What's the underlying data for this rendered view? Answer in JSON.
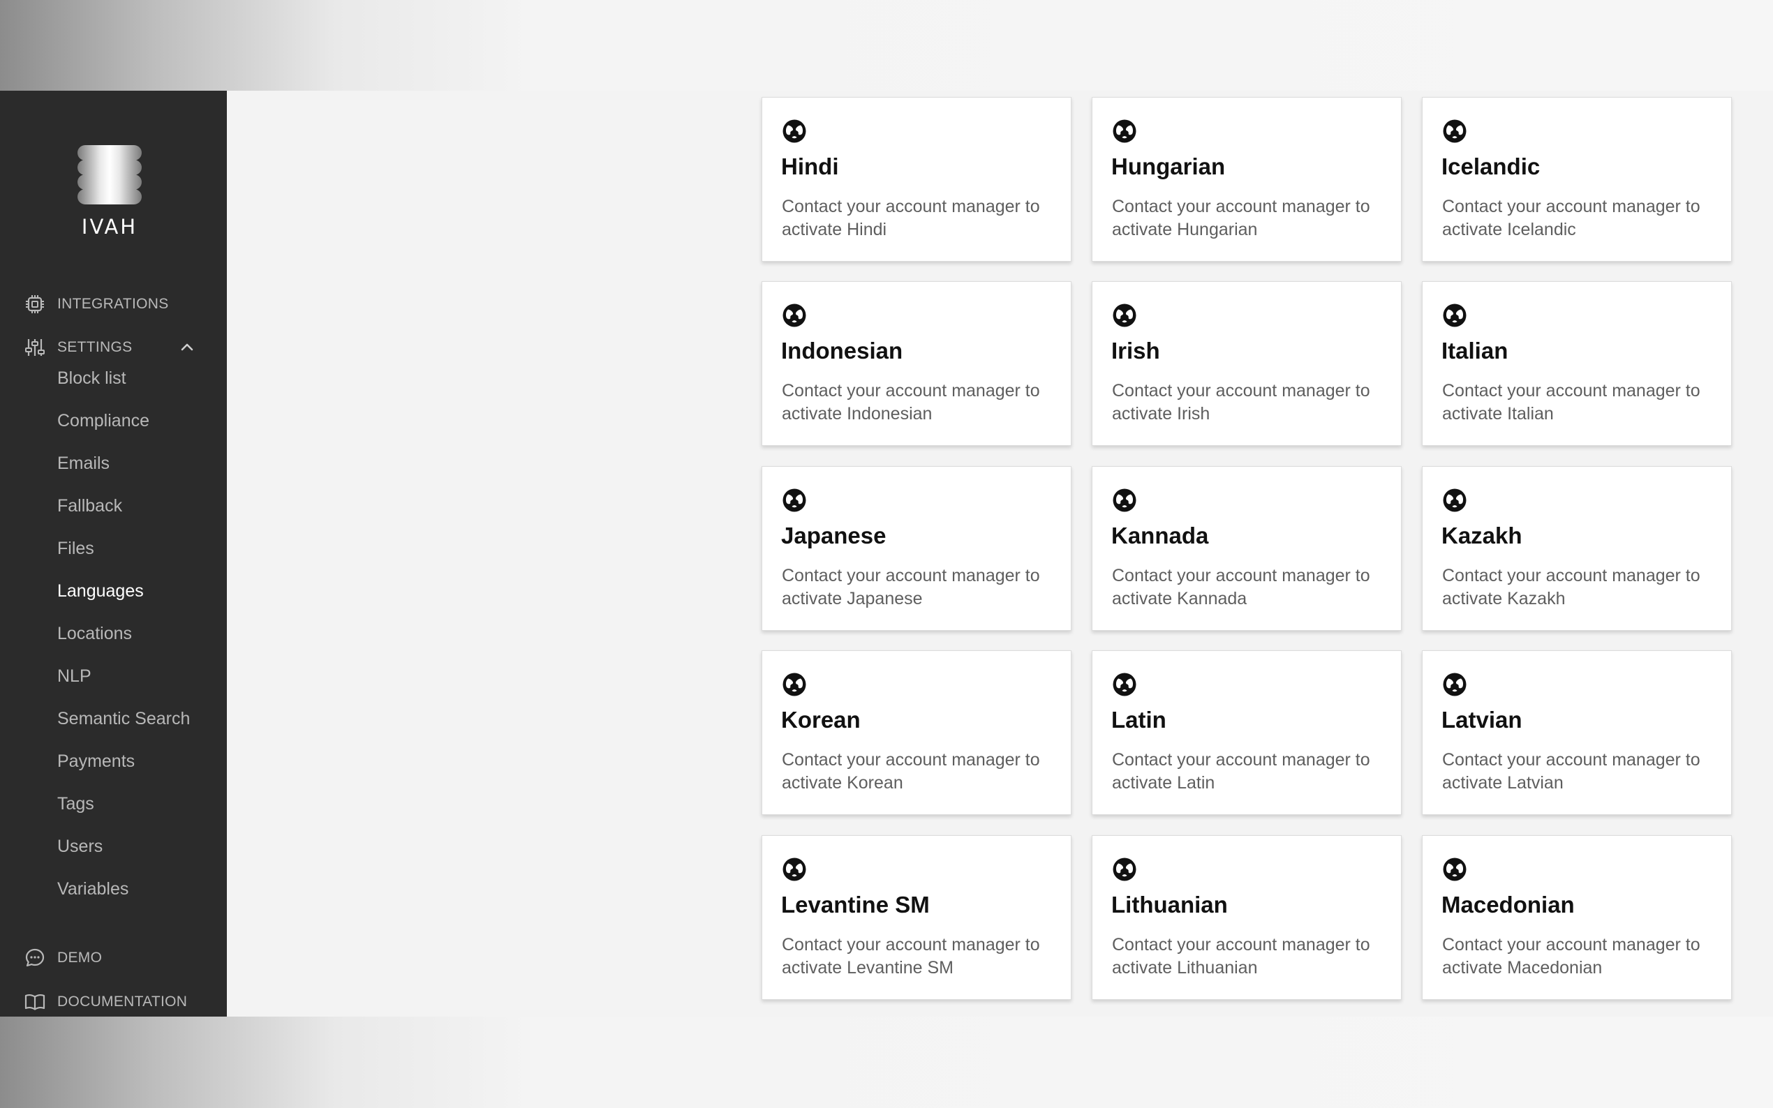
{
  "brand": {
    "name": "IVAH"
  },
  "nav": {
    "integrations": "INTEGRATIONS",
    "settings": "SETTINGS",
    "settings_items": [
      "Block list",
      "Compliance",
      "Emails",
      "Fallback",
      "Files",
      "Languages",
      "Locations",
      "NLP",
      "Semantic Search",
      "Payments",
      "Tags",
      "Users",
      "Variables"
    ],
    "active_item": "Languages",
    "demo": "DEMO",
    "documentation": "DOCUMENTATION"
  },
  "languages": [
    {
      "name": "Hindi",
      "desc": "Contact your account manager to activate Hindi"
    },
    {
      "name": "Hungarian",
      "desc": "Contact your account manager to activate Hungarian"
    },
    {
      "name": "Icelandic",
      "desc": "Contact your account manager to activate Icelandic"
    },
    {
      "name": "Indonesian",
      "desc": "Contact your account manager to activate Indonesian"
    },
    {
      "name": "Irish",
      "desc": "Contact your account manager to activate Irish"
    },
    {
      "name": "Italian",
      "desc": "Contact your account manager to activate Italian"
    },
    {
      "name": "Japanese",
      "desc": "Contact your account manager to activate Japanese"
    },
    {
      "name": "Kannada",
      "desc": "Contact your account manager to activate Kannada"
    },
    {
      "name": "Kazakh",
      "desc": "Contact your account manager to activate Kazakh"
    },
    {
      "name": "Korean",
      "desc": "Contact your account manager to activate Korean"
    },
    {
      "name": "Latin",
      "desc": "Contact your account manager to activate Latin"
    },
    {
      "name": "Latvian",
      "desc": "Contact your account manager to activate Latvian"
    },
    {
      "name": "Levantine SM",
      "desc": "Contact your account manager to activate Levantine SM"
    },
    {
      "name": "Lithuanian",
      "desc": "Contact your account manager to activate Lithuanian"
    },
    {
      "name": "Macedonian",
      "desc": "Contact your account manager to activate Macedonian"
    }
  ],
  "icons": {
    "card": "globe-icon"
  },
  "colors": {
    "sidebar": "#2b2b2b",
    "active_text": "#ffffff",
    "muted_text": "#b8b8b8",
    "card_bg": "#ffffff"
  }
}
